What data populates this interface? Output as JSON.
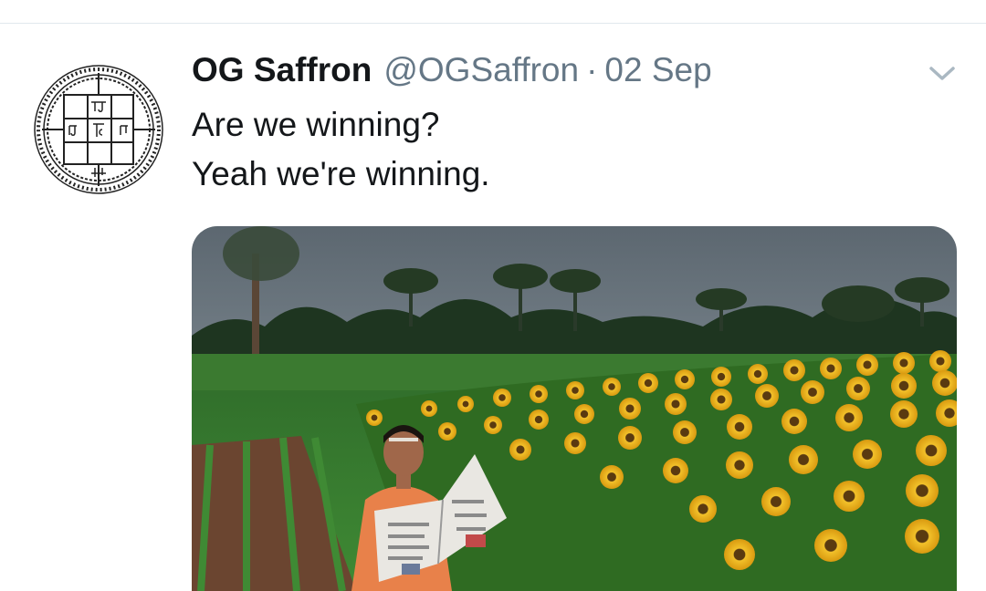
{
  "tweet": {
    "display_name": "OG Saffron",
    "handle": "@OGSaffron",
    "separator": "·",
    "date": "02 Sep",
    "text_lines": [
      "Are we winning?",
      "Yeah we're winning."
    ]
  },
  "icons": {
    "menu": "chevron-down-icon",
    "avatar": "mandala-seal-icon"
  },
  "media": {
    "alt": "Man in orange kurta reading a newspaper in a sunflower field"
  },
  "colors": {
    "name": "#14171a",
    "secondary": "#657786",
    "divider": "#e1e8ed",
    "chevron": "#aab8c2"
  }
}
